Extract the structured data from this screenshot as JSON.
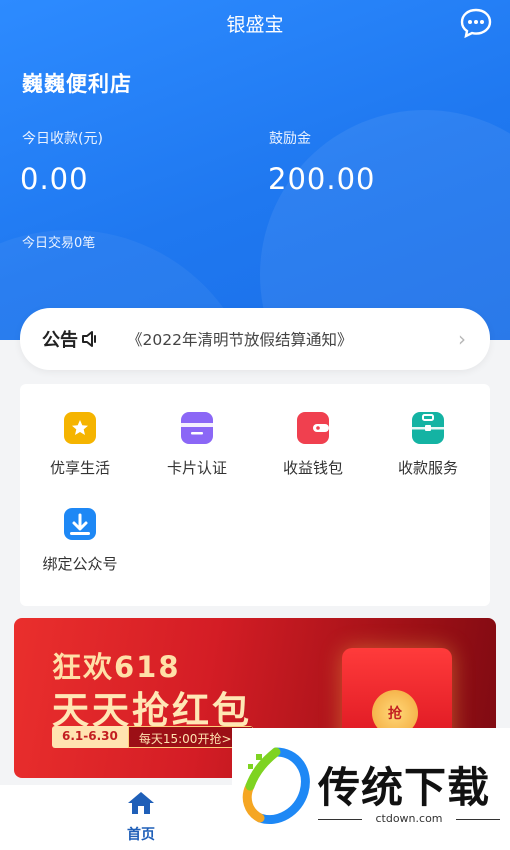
{
  "header": {
    "title": "银盛宝",
    "store_name": "巍巍便利店",
    "today_income_label": "今日收款(元)",
    "today_income_value": "0.00",
    "bonus_label": "鼓励金",
    "bonus_value": "200.00",
    "today_trades": "今日交易0笔"
  },
  "notice": {
    "tag": "公告",
    "text": "《2022年清明节放假结算通知》"
  },
  "services": [
    {
      "label": "优享生活",
      "icon": "star-icon",
      "color": "#f5b400"
    },
    {
      "label": "卡片认证",
      "icon": "card-icon",
      "color": "#8b67f6"
    },
    {
      "label": "收益钱包",
      "icon": "wallet-icon",
      "color": "#f0404f"
    },
    {
      "label": "收款服务",
      "icon": "briefcase-icon",
      "color": "#14b3a3"
    },
    {
      "label": "绑定公众号",
      "icon": "download-icon",
      "color": "#1e88f5"
    }
  ],
  "banner": {
    "line1": "狂欢618",
    "line2": "天天抢红包",
    "date": "6.1-6.30",
    "time": "每天15:00开抢>>",
    "coin": "抢"
  },
  "tabbar": {
    "home": "首页"
  },
  "watermark": {
    "name": "传统下载",
    "url": "ctdown.com"
  }
}
